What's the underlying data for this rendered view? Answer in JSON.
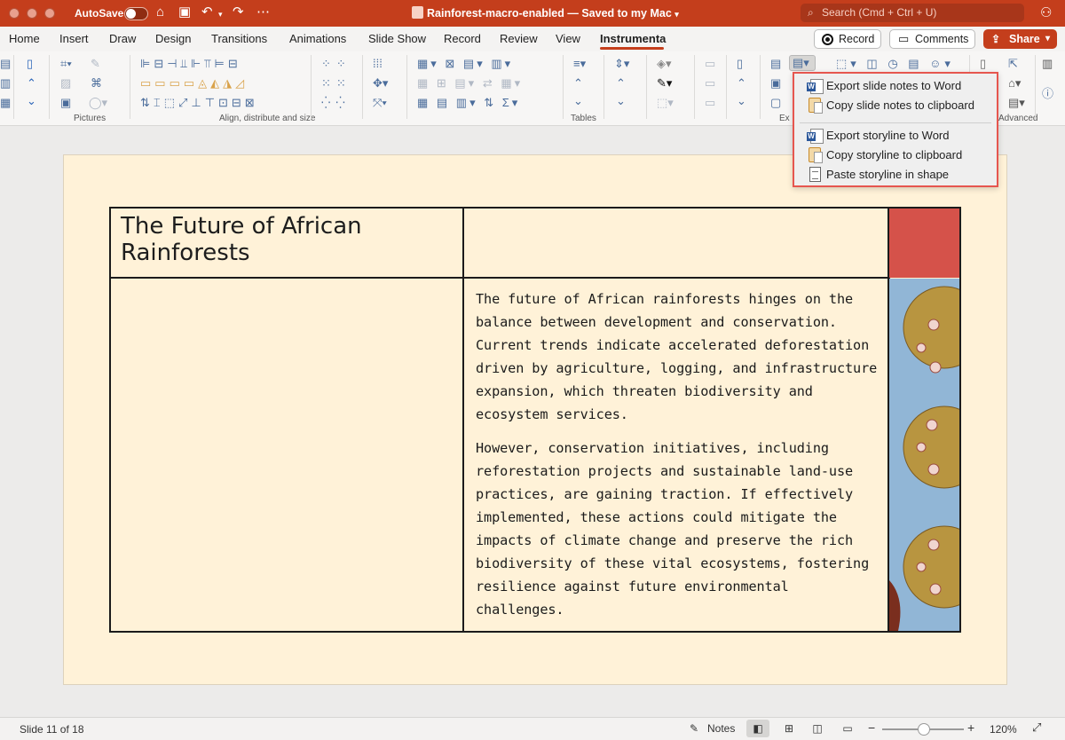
{
  "titlebar": {
    "autosave_label": "AutoSave",
    "doc_title": "Rainforest-macro-enabled — Saved to my Mac",
    "search_placeholder": "Search (Cmd + Ctrl + U)"
  },
  "tabs": [
    "Home",
    "Insert",
    "Draw",
    "Design",
    "Transitions",
    "Animations",
    "Slide Show",
    "Record",
    "Review",
    "View",
    "Instrumenta"
  ],
  "active_tab": "Instrumenta",
  "actions": {
    "record": "Record",
    "comments": "Comments",
    "share": "Share"
  },
  "ribbon": {
    "groups": {
      "pictures": "Pictures",
      "align": "Align, distribute and size",
      "tables": "Tables",
      "export_partial": "Ex",
      "advanced_partial": "Advanced"
    }
  },
  "dropdown_menu": {
    "items": [
      {
        "label": "Export slide notes to Word",
        "icon": "word-export-icon"
      },
      {
        "label": "Copy slide notes to clipboard",
        "icon": "clipboard-icon"
      },
      {
        "label": "Export storyline to Word",
        "icon": "word-export-icon"
      },
      {
        "label": "Copy storyline to clipboard",
        "icon": "clipboard-icon"
      },
      {
        "label": "Paste storyline in shape",
        "icon": "page-icon"
      }
    ],
    "highlight_color": "#e6564f"
  },
  "slide": {
    "title": "The Future of African Rainforests",
    "paragraph1_lines": [
      "The future of African rainforests hinges on the",
      "balance between development and conservation.",
      "Current trends indicate accelerated deforestation",
      "driven by agriculture, logging, and infrastructure",
      "expansion, which threaten biodiversity and",
      "ecosystem services."
    ],
    "paragraph2_lines": [
      "However, conservation initiatives, including",
      "reforestation projects and sustainable land-use",
      "practices, are gaining traction. If effectively",
      "implemented, these actions could mitigate the",
      "impacts of climate change and preserve the rich",
      "biodiversity of these vital ecosystems, fostering",
      "resilience against future environmental",
      "challenges."
    ],
    "background_color": "#fff2d8",
    "accent_color": "#d5524a"
  },
  "statusbar": {
    "slide_count": "Slide 11 of 18",
    "notes_label": "Notes",
    "zoom": "120%"
  },
  "colors": {
    "brand": "#c43e1c"
  }
}
